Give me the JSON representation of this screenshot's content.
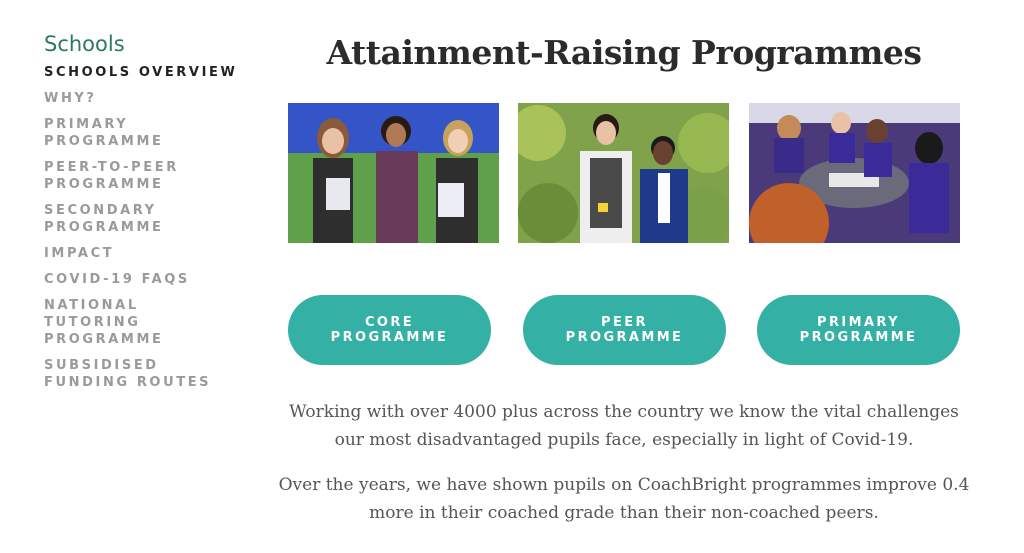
{
  "sidebar": {
    "title": "Schools",
    "items": [
      {
        "label": "SCHOOLS OVERVIEW",
        "active": true
      },
      {
        "label": "WHY?"
      },
      {
        "label": "PRIMARY PROGRAMME"
      },
      {
        "label": "PEER-TO-PEER PROGRAMME"
      },
      {
        "label": "SECONDARY PROGRAMME"
      },
      {
        "label": "IMPACT"
      },
      {
        "label": "COVID-19 FAQS"
      },
      {
        "label": "NATIONAL TUTORING PROGRAMME"
      },
      {
        "label": "SUBSIDISED FUNDING ROUTES"
      }
    ]
  },
  "main": {
    "title": "Attainment-Raising Programmes",
    "buttons": [
      {
        "label": "CORE\nPROGRAMME"
      },
      {
        "label": "PEER\nPROGRAMME"
      },
      {
        "label": "PRIMARY\nPROGRAMME"
      }
    ],
    "paragraphs": [
      "Working with over 4000 plus across the country we know the vital challenges our most disadvantaged pupils face, especially in light of Covid-19.",
      "Over the years, we have shown pupils on CoachBright programmes improve 0.4 more in their coached grade than their non-coached peers."
    ]
  },
  "colors": {
    "accent": "#35b0a4",
    "sidebar_title": "#2a7a5c",
    "nav_active": "#222222",
    "nav_inactive": "#9a9a9a"
  }
}
